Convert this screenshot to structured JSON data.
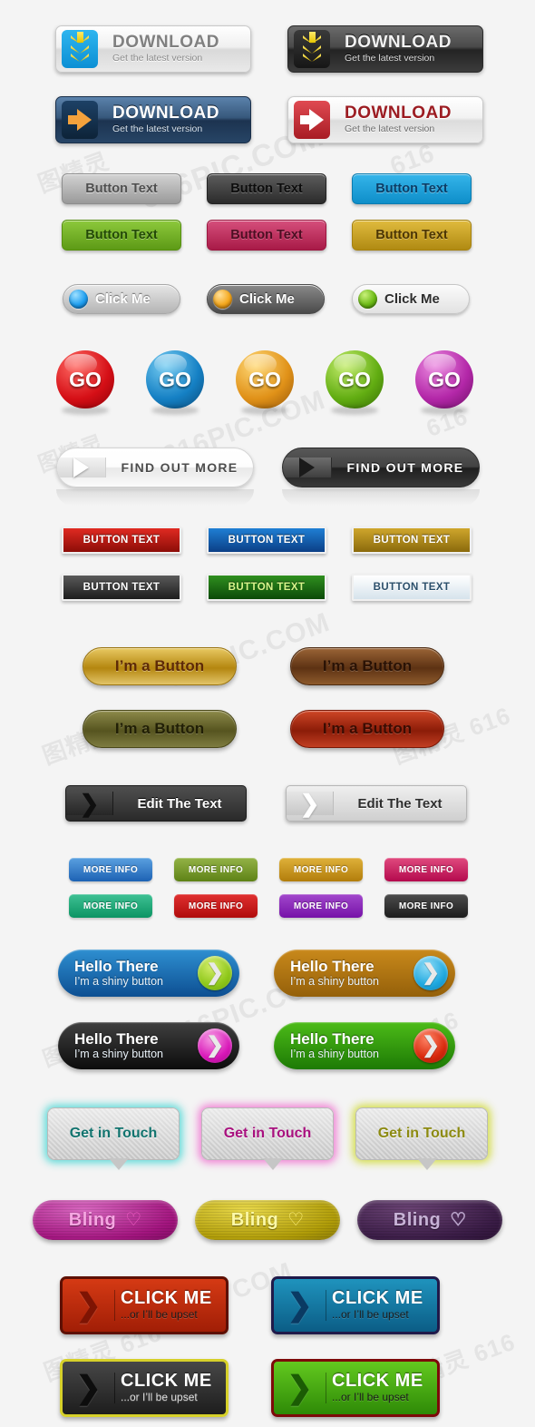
{
  "page": {
    "background": "#f4f4f4",
    "watermark_text": "616PIC.COM",
    "watermark_cn": "图精灵"
  },
  "sets": {
    "download": {
      "title": "DOWNLOAD",
      "subtitle": "Get the latest version",
      "buttons": [
        {
          "name": "download-light",
          "icon": "double-down-arrow-icon",
          "accent": "#0b8fd4"
        },
        {
          "name": "download-dark",
          "icon": "double-down-arrow-icon",
          "accent": "#232323"
        },
        {
          "name": "download-blue",
          "icon": "right-arrow-icon",
          "accent": "#1c3350"
        },
        {
          "name": "download-red",
          "icon": "right-arrow-icon",
          "accent": "#a81c24"
        }
      ]
    },
    "button_text": {
      "label": "Button Text",
      "variants": [
        {
          "name": "button-text-grey",
          "color": "#9a9a9a"
        },
        {
          "name": "button-text-black",
          "color": "#2b2b2b"
        },
        {
          "name": "button-text-blue",
          "color": "#0e8ec9"
        },
        {
          "name": "button-text-green",
          "color": "#5d9a16"
        },
        {
          "name": "button-text-pink",
          "color": "#a81a47"
        },
        {
          "name": "button-text-gold",
          "color": "#b08a12"
        }
      ]
    },
    "click_me_pill": {
      "label": "Click Me",
      "variants": [
        {
          "name": "click-me-silver",
          "dot": "#1f9ff0"
        },
        {
          "name": "click-me-dark",
          "dot": "#f5a81d"
        },
        {
          "name": "click-me-white",
          "dot": "#6cbb16"
        }
      ]
    },
    "go_orbs": {
      "label": "GO",
      "variants": [
        {
          "name": "go-orb-red",
          "color": "#d50f16"
        },
        {
          "name": "go-orb-blue",
          "color": "#1580c4"
        },
        {
          "name": "go-orb-orange",
          "color": "#e09118"
        },
        {
          "name": "go-orb-green",
          "color": "#62ad12"
        },
        {
          "name": "go-orb-purple",
          "color": "#b327a8"
        }
      ]
    },
    "find_out_more": {
      "label": "FIND OUT MORE",
      "variants": [
        {
          "name": "find-out-more-light",
          "icon": "play-triangle-icon"
        },
        {
          "name": "find-out-more-dark",
          "icon": "play-triangle-icon"
        }
      ]
    },
    "button_text_caps": {
      "label": "BUTTON TEXT",
      "variants": [
        {
          "name": "button-text-caps-red",
          "color": "#8c0d08"
        },
        {
          "name": "button-text-caps-blue",
          "color": "#0b3f86"
        },
        {
          "name": "button-text-caps-gold",
          "color": "#8a6a0c"
        },
        {
          "name": "button-text-caps-carbon",
          "color": "#1d1d1d"
        },
        {
          "name": "button-text-caps-green",
          "color": "#0c4a08"
        },
        {
          "name": "button-text-caps-white",
          "color": "#d6e3ec"
        }
      ]
    },
    "im_a_button": {
      "label": "I’m a Button",
      "variants": [
        {
          "name": "im-a-button-gold",
          "color": "#b4860f"
        },
        {
          "name": "im-a-button-brown",
          "color": "#5d3213"
        },
        {
          "name": "im-a-button-olive",
          "color": "#56541f"
        },
        {
          "name": "im-a-button-red",
          "color": "#8b1c08"
        }
      ]
    },
    "edit_the_text": {
      "label": "Edit The Text",
      "variants": [
        {
          "name": "edit-the-text-dark",
          "icon": "chevron-right-icon"
        },
        {
          "name": "edit-the-text-light",
          "icon": "chevron-right-icon"
        }
      ]
    },
    "more_info": {
      "label": "MORE INFO",
      "variants": [
        {
          "name": "more-info-blue",
          "color": "#1d62b4"
        },
        {
          "name": "more-info-olive",
          "color": "#5e8216"
        },
        {
          "name": "more-info-gold",
          "color": "#b27d0b"
        },
        {
          "name": "more-info-pink",
          "color": "#b4094d"
        },
        {
          "name": "more-info-teal",
          "color": "#0c9463"
        },
        {
          "name": "more-info-red",
          "color": "#b00b0b"
        },
        {
          "name": "more-info-purple",
          "color": "#7612a8"
        },
        {
          "name": "more-info-black",
          "color": "#1c1c1c"
        }
      ]
    },
    "hello_there": {
      "title": "Hello There",
      "subtitle": "I’m a shiny button",
      "variants": [
        {
          "name": "hello-there-blue",
          "body": "#0d4f92",
          "circle": "#8ec71a"
        },
        {
          "name": "hello-there-gold",
          "body": "#94600a",
          "circle": "#1fa8df"
        },
        {
          "name": "hello-there-black",
          "body": "#0c0c0c",
          "circle": "#d817b8"
        },
        {
          "name": "hello-there-green",
          "body": "#1d7a05",
          "circle": "#d8290c"
        }
      ]
    },
    "get_in_touch": {
      "label": "Get in Touch",
      "variants": [
        {
          "name": "get-in-touch-teal",
          "glow": "#43d6d4",
          "text": "#11736e"
        },
        {
          "name": "get-in-touch-pink",
          "glow": "#ee6ace",
          "text": "#a8107e"
        },
        {
          "name": "get-in-touch-lime",
          "glow": "#ced828",
          "text": "#8c8a10"
        }
      ]
    },
    "bling": {
      "label": "Bling",
      "heart_icon": "heart-icon",
      "variants": [
        {
          "name": "bling-pink",
          "color": "#a3157f"
        },
        {
          "name": "bling-gold",
          "color": "#b09c08"
        },
        {
          "name": "bling-purple",
          "color": "#3a1c46"
        }
      ]
    },
    "click_me_big": {
      "title": "CLICK ME",
      "subtitle": "...or I’ll be upset",
      "icon": "chevron-right-icon",
      "variants": [
        {
          "name": "click-me-big-red",
          "body": "#a11e06",
          "border": "#5d1003"
        },
        {
          "name": "click-me-big-blue",
          "body": "#0b5d86",
          "border": "#201a4a"
        },
        {
          "name": "click-me-big-black",
          "body": "#1d1d1d",
          "border": "#d6d02a"
        },
        {
          "name": "click-me-big-green",
          "body": "#2e8a07",
          "border": "#7d0a0a"
        }
      ]
    }
  }
}
